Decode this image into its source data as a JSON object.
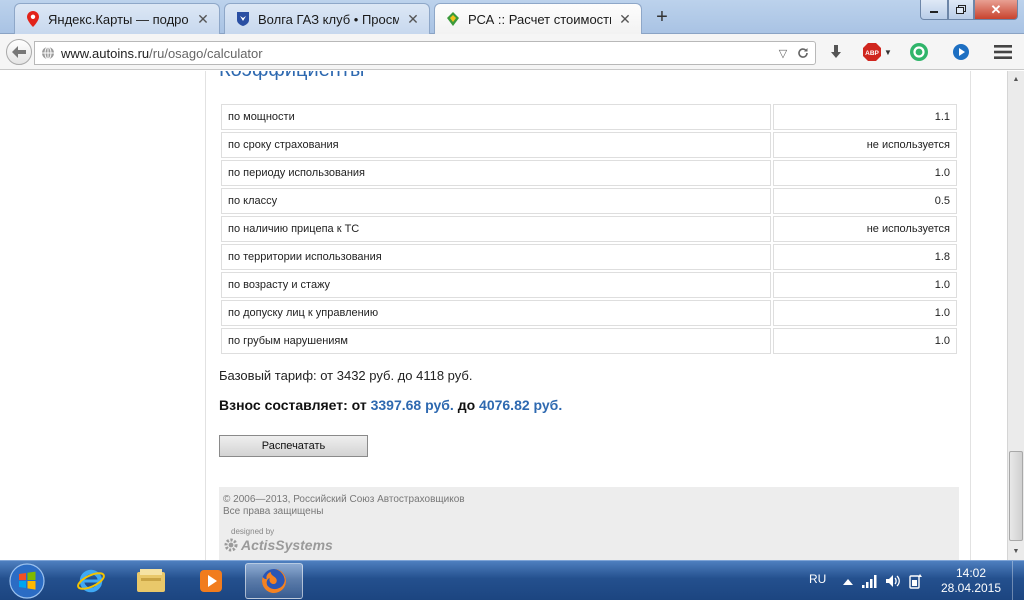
{
  "browser": {
    "tabs": [
      {
        "title": "Яндекс.Карты — подробн…",
        "icon": "map-pin-icon",
        "active": false
      },
      {
        "title": "Волга ГАЗ клуб • Просмо…",
        "icon": "gaz-logo-icon",
        "active": false
      },
      {
        "title": "РСА :: Расчет стоимости …",
        "icon": "rsa-logo-icon",
        "active": true
      }
    ],
    "new_tab_label": "+",
    "url_host": "www.autoins.ru",
    "url_path": "/ru/osago/calculator",
    "toolbar_icons": [
      "download-icon",
      "adblock-icon",
      "sync-icon",
      "media-icon",
      "menu-icon"
    ],
    "adblock_label": "ABP"
  },
  "page": {
    "heading": "Коэффициенты",
    "coefficients": [
      {
        "label": "по мощности",
        "value": "1.1"
      },
      {
        "label": "по сроку страхования",
        "value": "не используется"
      },
      {
        "label": "по периоду использования",
        "value": "1.0"
      },
      {
        "label": "по классу",
        "value": "0.5"
      },
      {
        "label": "по наличию прицепа к ТС",
        "value": "не используется"
      },
      {
        "label": "по территории использования",
        "value": "1.8"
      },
      {
        "label": "по возрасту и стажу",
        "value": "1.0"
      },
      {
        "label": "по допуску лиц к управлению",
        "value": "1.0"
      },
      {
        "label": "по грубым нарушениям",
        "value": "1.0"
      }
    ],
    "base_tariff": "Базовый тариф: от 3432 руб. до 4118 руб.",
    "premium": {
      "label": "Взнос составляет:",
      "from_word": "от",
      "from_value": "3397.68 руб.",
      "to_word": "до",
      "to_value": "4076.82 руб."
    },
    "print_button": "Распечатать",
    "footer": {
      "copyright": "© 2006—2013, Российский Союз Автостраховщиков",
      "rights": "Все права защищены",
      "designed_by": "designed by",
      "designer": "ActisSystems"
    }
  },
  "taskbar": {
    "apps": [
      "ie-icon",
      "explorer-icon",
      "media-player-icon",
      "firefox-icon"
    ],
    "language": "RU",
    "time": "14:02",
    "date": "28.04.2015"
  },
  "colors": {
    "accent_blue": "#2e69b0",
    "taskbar": "#24508e"
  }
}
